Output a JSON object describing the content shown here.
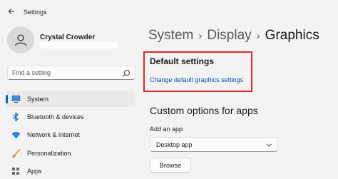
{
  "window": {
    "title": "Settings"
  },
  "profile": {
    "name": "Crystal Crowder"
  },
  "search": {
    "placeholder": "Find a setting"
  },
  "sidebar": {
    "items": [
      {
        "label": "System",
        "icon": "monitor-icon",
        "selected": true
      },
      {
        "label": "Bluetooth & devices",
        "icon": "bluetooth-icon"
      },
      {
        "label": "Network & internet",
        "icon": "wifi-icon"
      },
      {
        "label": "Personalization",
        "icon": "brush-icon"
      },
      {
        "label": "Apps",
        "icon": "apps-icon"
      }
    ]
  },
  "breadcrumb": {
    "parent1": "System",
    "parent2": "Display",
    "current": "Graphics"
  },
  "default_settings": {
    "title": "Default settings",
    "link": "Change default graphics settings"
  },
  "custom": {
    "title": "Custom options for apps",
    "add_label": "Add an app",
    "dropdown_value": "Desktop app",
    "browse_label": "Browse"
  },
  "colors": {
    "accent": "#0067c0",
    "highlight_border": "#e0262f",
    "link": "#0050a8"
  }
}
